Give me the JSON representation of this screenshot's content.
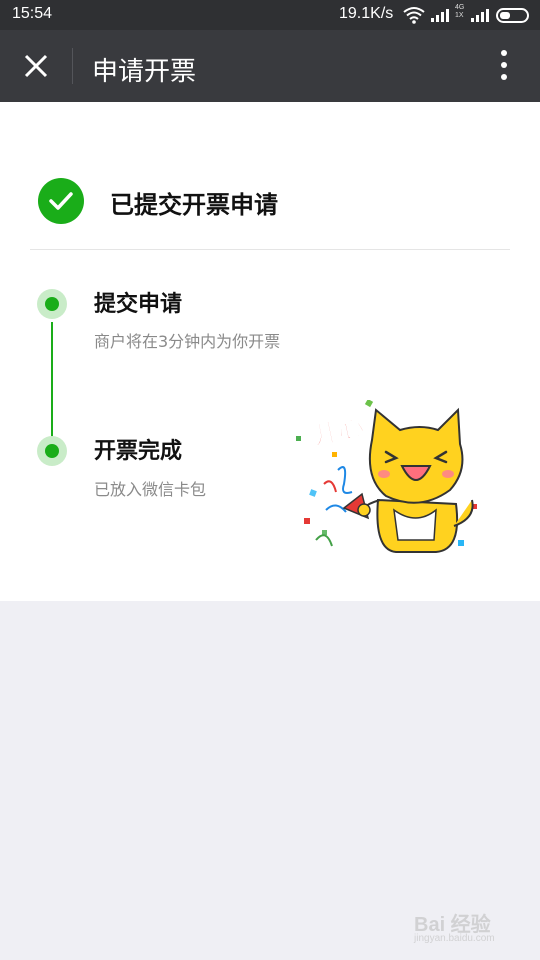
{
  "status_bar": {
    "time": "15:54",
    "network_speed": "19.1K/s",
    "sig_label_top": "4G",
    "sig_label_bottom": "1X",
    "icons": [
      "wifi-icon",
      "signal-icon",
      "signal-icon",
      "battery-icon"
    ]
  },
  "navbar": {
    "title": "申请开票",
    "close_icon": "close-icon",
    "more_icon": "more-vertical-icon"
  },
  "result": {
    "icon": "check-circle-icon",
    "text": "已提交开票申请"
  },
  "steps": [
    {
      "title": "提交申请",
      "desc": "商户将在3分钟内为你开票"
    },
    {
      "title": "开票完成",
      "desc": "已放入微信卡包"
    }
  ],
  "sticker": {
    "text": "开心",
    "icon": "happy-cat-sticker"
  },
  "watermark": {
    "text": "Bai 经验",
    "sub": "jingyan.baidu.com"
  },
  "colors": {
    "accent": "#1aad19",
    "navbar": "#393a3e",
    "statusbar": "#2f3033",
    "background": "#efeff4"
  }
}
